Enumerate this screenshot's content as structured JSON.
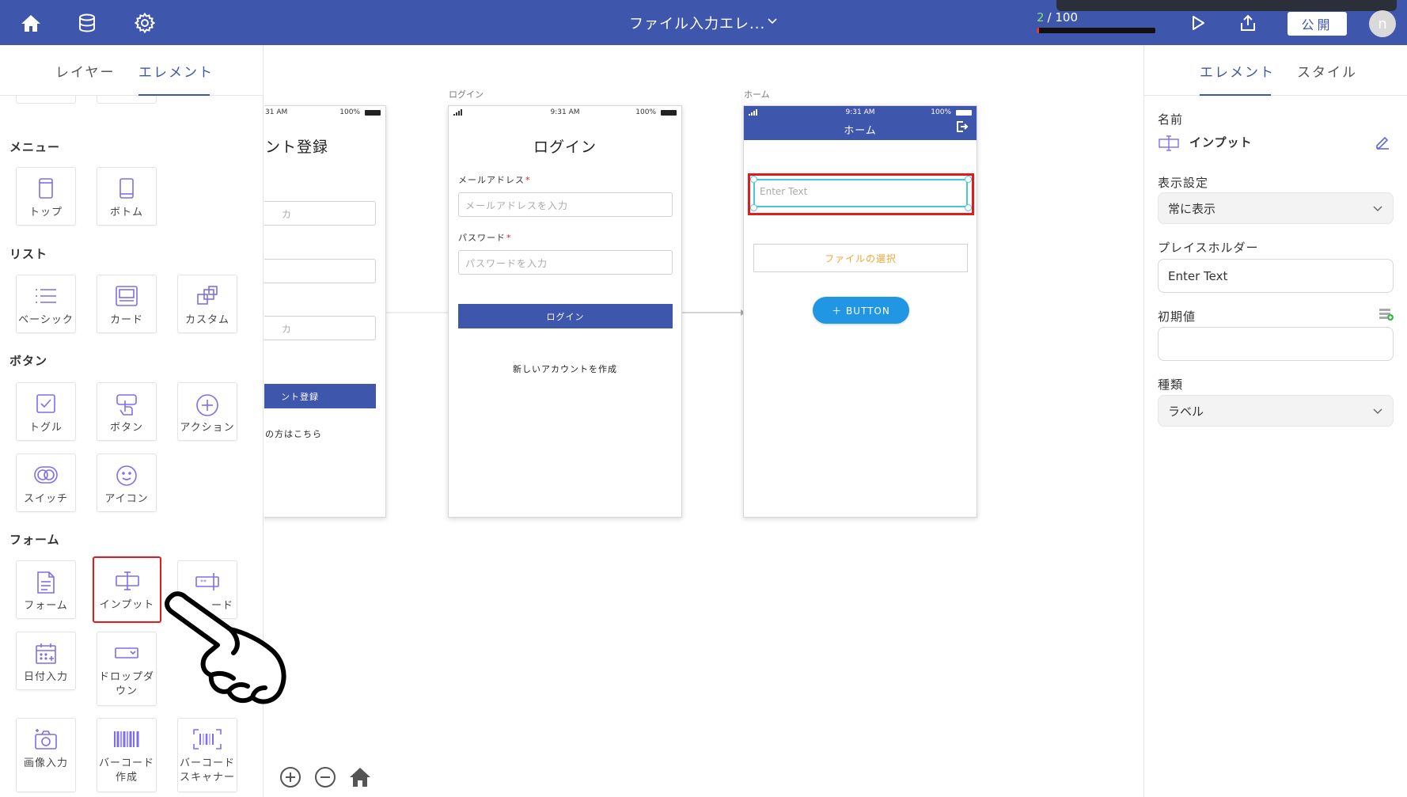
{
  "topbar": {
    "title": "ファイル入力エレ...",
    "counter_current": "2",
    "counter_total": "/ 100",
    "progress": 0.02,
    "publish_label": "公開",
    "avatar_initial": "n",
    "icons": [
      "home-icon",
      "database-icon",
      "gear-icon",
      "chevron-down-icon",
      "play-icon",
      "share-icon"
    ]
  },
  "left_panel": {
    "tabs": [
      "レイヤー",
      "エレメント"
    ],
    "active_tab": "エレメント",
    "sections": {
      "menu": "メニュー",
      "list": "リスト",
      "button": "ボタン",
      "form": "フォーム"
    },
    "tiles": {
      "top": "トップ",
      "bottom": "ボトム",
      "basic": "ベーシック",
      "card": "カード",
      "custom": "カスタム",
      "toggle": "トグル",
      "button": "ボタン",
      "action": "アクション",
      "switch": "スイッチ",
      "icon": "アイコン",
      "form": "フォーム",
      "input": "インプット",
      "code": "ード",
      "date_input": "日付入力",
      "dropdown_1": "ドロップダ",
      "dropdown_2": "ウン",
      "image_input": "画像入力",
      "barcode_create_1": "バーコード",
      "barcode_create_2": "作成",
      "barcode_scanner_1": "バーコード",
      "barcode_scanner_2": "スキャナー"
    }
  },
  "canvas": {
    "signup_screen": {
      "status_time": "31 AM",
      "status_battery": "100%",
      "title": "ント登録",
      "input_hint_1": "カ",
      "input_hint_3": "カ",
      "button_label": "ント登録",
      "link": "の方はこちら"
    },
    "login_screen": {
      "label": "ログイン",
      "status_time": "9:31 AM",
      "status_battery": "100%",
      "title": "ログイン",
      "email_label": "メールアドレス",
      "email_placeholder": "メールアドレスを入力",
      "password_label": "パスワード",
      "password_placeholder": "パスワードを入力",
      "required_mark": "*",
      "login_button": "ログイン",
      "create_account_link": "新しいアカウントを作成"
    },
    "home_screen": {
      "label": "ホーム",
      "status_time": "9:31 AM",
      "status_battery": "100%",
      "header_title": "ホーム",
      "input_placeholder": "Enter Text",
      "file_button": "ファイルの選択",
      "button_label": "＋  BUTTON"
    }
  },
  "right_panel": {
    "tabs": [
      "エレメント",
      "スタイル"
    ],
    "active_tab": "エレメント",
    "name_label": "名前",
    "name_value": "インプット",
    "visibility_label": "表示設定",
    "visibility_value": "常に表示",
    "placeholder_label": "プレイスホルダー",
    "placeholder_value": "Enter Text",
    "initial_value_label": "初期値",
    "initial_value": "",
    "type_label": "種類",
    "type_value": "ラベル"
  },
  "colors": {
    "brand": "#3f56ad",
    "highlight": "#e21b1b",
    "accent_button": "#2196e3",
    "file_button_text": "#f3a534",
    "selection": "#48c7d6"
  }
}
